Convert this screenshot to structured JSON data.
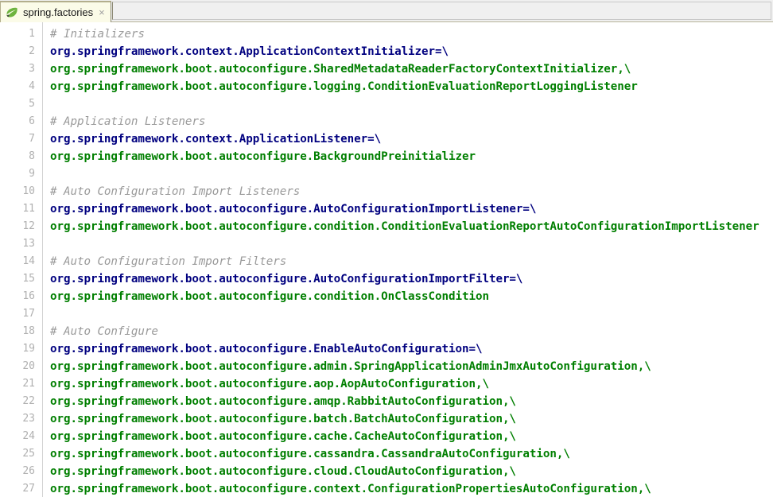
{
  "window": {
    "tab": {
      "icon": "spring-leaf-icon",
      "label": "spring.factories",
      "close_label": "×"
    }
  },
  "editor": {
    "first_line_number": 1,
    "last_line_number": 27,
    "colors": {
      "comment": "#9a9a9a",
      "key": "#00007f",
      "value": "#007f00",
      "gutter_text": "#b0b0b0",
      "background": "#ffffff",
      "tab_active_bg": "#fbfbe8",
      "tabbar_bg": "#f0f0f0"
    },
    "lines": [
      {
        "n": 1,
        "type": "comment",
        "text": "# Initializers"
      },
      {
        "n": 2,
        "type": "key",
        "text": "org.springframework.context.ApplicationContextInitializer=\\"
      },
      {
        "n": 3,
        "type": "value",
        "text": "org.springframework.boot.autoconfigure.SharedMetadataReaderFactoryContextInitializer,\\"
      },
      {
        "n": 4,
        "type": "value",
        "text": "org.springframework.boot.autoconfigure.logging.ConditionEvaluationReportLoggingListener"
      },
      {
        "n": 5,
        "type": "blank",
        "text": ""
      },
      {
        "n": 6,
        "type": "comment",
        "text": "# Application Listeners"
      },
      {
        "n": 7,
        "type": "key",
        "text": "org.springframework.context.ApplicationListener=\\"
      },
      {
        "n": 8,
        "type": "value",
        "text": "org.springframework.boot.autoconfigure.BackgroundPreinitializer"
      },
      {
        "n": 9,
        "type": "blank",
        "text": ""
      },
      {
        "n": 10,
        "type": "comment",
        "text": "# Auto Configuration Import Listeners"
      },
      {
        "n": 11,
        "type": "key",
        "text": "org.springframework.boot.autoconfigure.AutoConfigurationImportListener=\\"
      },
      {
        "n": 12,
        "type": "value",
        "text": "org.springframework.boot.autoconfigure.condition.ConditionEvaluationReportAutoConfigurationImportListener"
      },
      {
        "n": 13,
        "type": "blank",
        "text": ""
      },
      {
        "n": 14,
        "type": "comment",
        "text": "# Auto Configuration Import Filters"
      },
      {
        "n": 15,
        "type": "key",
        "text": "org.springframework.boot.autoconfigure.AutoConfigurationImportFilter=\\"
      },
      {
        "n": 16,
        "type": "value",
        "text": "org.springframework.boot.autoconfigure.condition.OnClassCondition"
      },
      {
        "n": 17,
        "type": "blank",
        "text": ""
      },
      {
        "n": 18,
        "type": "comment",
        "text": "# Auto Configure"
      },
      {
        "n": 19,
        "type": "key",
        "text": "org.springframework.boot.autoconfigure.EnableAutoConfiguration=\\"
      },
      {
        "n": 20,
        "type": "value",
        "text": "org.springframework.boot.autoconfigure.admin.SpringApplicationAdminJmxAutoConfiguration,\\"
      },
      {
        "n": 21,
        "type": "value",
        "text": "org.springframework.boot.autoconfigure.aop.AopAutoConfiguration,\\"
      },
      {
        "n": 22,
        "type": "value",
        "text": "org.springframework.boot.autoconfigure.amqp.RabbitAutoConfiguration,\\"
      },
      {
        "n": 23,
        "type": "value",
        "text": "org.springframework.boot.autoconfigure.batch.BatchAutoConfiguration,\\"
      },
      {
        "n": 24,
        "type": "value",
        "text": "org.springframework.boot.autoconfigure.cache.CacheAutoConfiguration,\\"
      },
      {
        "n": 25,
        "type": "value",
        "text": "org.springframework.boot.autoconfigure.cassandra.CassandraAutoConfiguration,\\"
      },
      {
        "n": 26,
        "type": "value",
        "text": "org.springframework.boot.autoconfigure.cloud.CloudAutoConfiguration,\\"
      },
      {
        "n": 27,
        "type": "value",
        "text": "org.springframework.boot.autoconfigure.context.ConfigurationPropertiesAutoConfiguration,\\"
      }
    ]
  }
}
